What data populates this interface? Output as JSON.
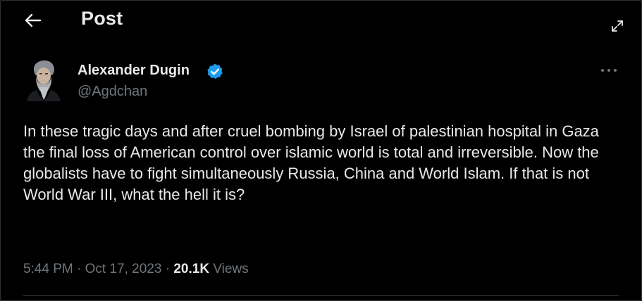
{
  "header": {
    "title": "Post",
    "back_icon": "arrow-left-icon",
    "expand_icon": "expand-arrows-icon"
  },
  "author": {
    "name": "Alexander Dugin",
    "handle": "@Agdchan",
    "verified": true,
    "verified_color": "#1d9bf0"
  },
  "post": {
    "text": "In these tragic days and after cruel bombing by Israel of palestinian hospital in Gaza the final loss of American control over islamic world is total and irreversible. Now the globalists have to fight simultaneously Russia, China and World Islam. If that is not World War III, what the hell it is?",
    "time": "5:44 PM",
    "separator": "·",
    "date": "Oct 17, 2023",
    "views_count": "20.1K",
    "views_label": "Views"
  },
  "more_icon": "more-horizontal-icon",
  "colors": {
    "background": "#000000",
    "text": "#e7e9ea",
    "muted": "#71767b",
    "border": "#2f3336",
    "accent": "#1d9bf0"
  }
}
